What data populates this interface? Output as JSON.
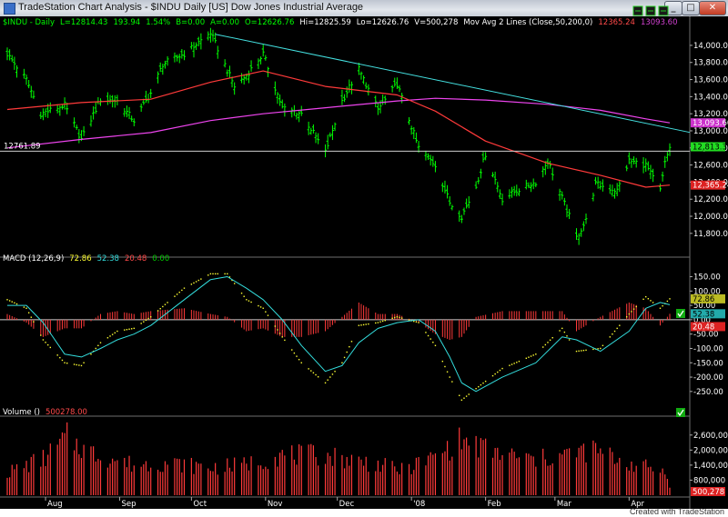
{
  "window": {
    "title": "TradeStation Chart Analysis - $INDU  Daily  [US] Dow Jones Industrial Average",
    "footer": "Created with TradeStation"
  },
  "price_panel": {
    "header": [
      {
        "text": "$INDU - Daily",
        "color": "#00ff00"
      },
      {
        "text": "L=12814.43",
        "color": "#00ff00"
      },
      {
        "text": "193.94",
        "color": "#00ff00"
      },
      {
        "text": "1.54%",
        "color": "#00ff00"
      },
      {
        "text": "B=0.00",
        "color": "#00ff00"
      },
      {
        "text": "A=0.00",
        "color": "#00ff00"
      },
      {
        "text": "O=12626.76",
        "color": "#00ff00"
      },
      {
        "text": "Hi=12825.59",
        "color": "#ffffff"
      },
      {
        "text": "Lo=12626.76",
        "color": "#ffffff"
      },
      {
        "text": "V=500,278",
        "color": "#ffffff"
      },
      {
        "text": "Mov Avg 2 Lines (Close,50,200,0)",
        "color": "#ffffff"
      },
      {
        "text": "12365.24",
        "color": "#ff4a4a"
      },
      {
        "text": "13093.60",
        "color": "#d040d0"
      }
    ],
    "hline_label": "12761.89",
    "flags": {
      "last": "12,813.37",
      "ma50": "12,365.24",
      "ma200": "13,093.60"
    }
  },
  "macd_panel": {
    "header": [
      {
        "text": "MACD (12,26,9)",
        "color": "#ffffff"
      },
      {
        "text": "72.86",
        "color": "#ffff33"
      },
      {
        "text": "52.38",
        "color": "#33dddd"
      },
      {
        "text": "20.48",
        "color": "#ff4a4a"
      },
      {
        "text": "0.00",
        "color": "#00cc00"
      }
    ],
    "flags": {
      "a": "72.86",
      "b": "52.38",
      "c": "20.48"
    }
  },
  "volume_panel": {
    "header": [
      {
        "text": "Volume ()",
        "color": "#ffffff"
      },
      {
        "text": "500278.00",
        "color": "#ff4a4a"
      }
    ],
    "flag": "500,278"
  },
  "colors": {
    "bars": "#00ff00",
    "ma50": "#ff3a3a",
    "ma200": "#ee44ee",
    "trend": "#44e0e0",
    "hist": "#ff3a3a",
    "macd": "#ffff33",
    "signal": "#33dddd",
    "volume": "#ff3a3a"
  },
  "chart_data": [
    {
      "type": "ohlc",
      "title": "$INDU - Daily",
      "x_categories": [
        "Aug",
        "Sep",
        "Oct",
        "Nov",
        "Dec",
        "'08",
        "Feb",
        "Mar",
        "Apr"
      ],
      "y_ticks": [
        "14,000.00",
        "13,800.00",
        "13,600.00",
        "13,400.00",
        "13,200.00",
        "13,000.00",
        "12,800.00",
        "12,600.00",
        "12,400.00",
        "12,200.00",
        "12,000.00",
        "11,800.00"
      ],
      "ylim": [
        11660,
        14180
      ],
      "close_anchors": [
        {
          "date": "2007-07-16",
          "close": 13900
        },
        {
          "date": "2007-07-24",
          "close": 13600
        },
        {
          "date": "2007-07-30",
          "close": 13200
        },
        {
          "date": "2007-08-09",
          "close": 13300
        },
        {
          "date": "2007-08-16",
          "close": 12900
        },
        {
          "date": "2007-08-24",
          "close": 13370
        },
        {
          "date": "2007-08-31",
          "close": 13350
        },
        {
          "date": "2007-09-07",
          "close": 13120
        },
        {
          "date": "2007-09-14",
          "close": 13440
        },
        {
          "date": "2007-09-19",
          "close": 13780
        },
        {
          "date": "2007-09-28",
          "close": 13900
        },
        {
          "date": "2007-10-09",
          "close": 14150
        },
        {
          "date": "2007-10-19",
          "close": 13520
        },
        {
          "date": "2007-10-24",
          "close": 13650
        },
        {
          "date": "2007-10-31",
          "close": 13900
        },
        {
          "date": "2007-11-08",
          "close": 13270
        },
        {
          "date": "2007-11-16",
          "close": 13200
        },
        {
          "date": "2007-11-26",
          "close": 12750
        },
        {
          "date": "2007-12-03",
          "close": 13350
        },
        {
          "date": "2007-12-10",
          "close": 13720
        },
        {
          "date": "2007-12-18",
          "close": 13250
        },
        {
          "date": "2007-12-26",
          "close": 13550
        },
        {
          "date": "2008-01-04",
          "close": 12800
        },
        {
          "date": "2008-01-11",
          "close": 12600
        },
        {
          "date": "2008-01-17",
          "close": 12160
        },
        {
          "date": "2008-01-22",
          "close": 12000
        },
        {
          "date": "2008-01-28",
          "close": 12350
        },
        {
          "date": "2008-02-01",
          "close": 12730
        },
        {
          "date": "2008-02-08",
          "close": 12200
        },
        {
          "date": "2008-02-14",
          "close": 12300
        },
        {
          "date": "2008-02-22",
          "close": 12400
        },
        {
          "date": "2008-02-27",
          "close": 12650
        },
        {
          "date": "2008-03-07",
          "close": 12000
        },
        {
          "date": "2008-03-10",
          "close": 11750
        },
        {
          "date": "2008-03-14",
          "close": 11950
        },
        {
          "date": "2008-03-18",
          "close": 12380
        },
        {
          "date": "2008-03-20",
          "close": 12360
        },
        {
          "date": "2008-03-27",
          "close": 12300
        },
        {
          "date": "2008-04-01",
          "close": 12650
        },
        {
          "date": "2008-04-08",
          "close": 12600
        },
        {
          "date": "2008-04-14",
          "close": 12300
        },
        {
          "date": "2008-04-16",
          "close": 12620
        },
        {
          "date": "2008-04-18",
          "close": 12813.37
        }
      ],
      "ma50_anchors": [
        {
          "date": "2007-07-16",
          "value": 13250
        },
        {
          "date": "2007-08-16",
          "value": 13330
        },
        {
          "date": "2007-09-14",
          "value": 13370
        },
        {
          "date": "2007-10-09",
          "value": 13570
        },
        {
          "date": "2007-10-31",
          "value": 13700
        },
        {
          "date": "2007-11-26",
          "value": 13520
        },
        {
          "date": "2007-12-26",
          "value": 13420
        },
        {
          "date": "2008-01-11",
          "value": 13230
        },
        {
          "date": "2008-02-01",
          "value": 12880
        },
        {
          "date": "2008-02-27",
          "value": 12620
        },
        {
          "date": "2008-03-20",
          "value": 12480
        },
        {
          "date": "2008-04-08",
          "value": 12340
        },
        {
          "date": "2008-04-18",
          "value": 12365.24
        }
      ],
      "ma200_anchors": [
        {
          "date": "2007-07-16",
          "value": 12800
        },
        {
          "date": "2007-08-16",
          "value": 12900
        },
        {
          "date": "2007-09-14",
          "value": 12980
        },
        {
          "date": "2007-10-09",
          "value": 13120
        },
        {
          "date": "2007-10-31",
          "value": 13200
        },
        {
          "date": "2007-11-26",
          "value": 13270
        },
        {
          "date": "2007-12-26",
          "value": 13350
        },
        {
          "date": "2008-01-11",
          "value": 13380
        },
        {
          "date": "2008-02-01",
          "value": 13360
        },
        {
          "date": "2008-02-27",
          "value": 13310
        },
        {
          "date": "2008-03-20",
          "value": 13240
        },
        {
          "date": "2008-04-08",
          "value": 13140
        },
        {
          "date": "2008-04-18",
          "value": 13093.6
        }
      ],
      "trendline": [
        {
          "date": "2007-10-11",
          "value": 14130
        },
        {
          "date": "2008-04-18",
          "value": 12950
        }
      ],
      "horizontal_line": 12761.89
    },
    {
      "type": "line",
      "title": "MACD (12,26,9)",
      "y_ticks": [
        "150.00",
        "100.00",
        "50.00",
        "0.00",
        "-50.00",
        "-100.00",
        "-150.00",
        "-200.00",
        "-250.00"
      ],
      "ylim": [
        -298,
        196
      ],
      "macd_anchors": [
        {
          "date": "2007-07-16",
          "value": 70
        },
        {
          "date": "2007-07-24",
          "value": 40
        },
        {
          "date": "2007-07-31",
          "value": -70
        },
        {
          "date": "2007-08-09",
          "value": -150
        },
        {
          "date": "2007-08-16",
          "value": -160
        },
        {
          "date": "2007-08-24",
          "value": -80
        },
        {
          "date": "2007-08-31",
          "value": -40
        },
        {
          "date": "2007-09-07",
          "value": -30
        },
        {
          "date": "2007-09-14",
          "value": 10
        },
        {
          "date": "2007-09-28",
          "value": 110
        },
        {
          "date": "2007-10-09",
          "value": 160
        },
        {
          "date": "2007-10-16",
          "value": 160
        },
        {
          "date": "2007-10-24",
          "value": 70
        },
        {
          "date": "2007-10-31",
          "value": 40
        },
        {
          "date": "2007-11-08",
          "value": -60
        },
        {
          "date": "2007-11-16",
          "value": -150
        },
        {
          "date": "2007-11-26",
          "value": -220
        },
        {
          "date": "2007-12-03",
          "value": -150
        },
        {
          "date": "2007-12-10",
          "value": -20
        },
        {
          "date": "2007-12-18",
          "value": -10
        },
        {
          "date": "2007-12-26",
          "value": 10
        },
        {
          "date": "2008-01-04",
          "value": -10
        },
        {
          "date": "2008-01-11",
          "value": -90
        },
        {
          "date": "2008-01-17",
          "value": -200
        },
        {
          "date": "2008-01-22",
          "value": -280
        },
        {
          "date": "2008-01-28",
          "value": -240
        },
        {
          "date": "2008-02-08",
          "value": -170
        },
        {
          "date": "2008-02-22",
          "value": -120
        },
        {
          "date": "2008-03-04",
          "value": -30
        },
        {
          "date": "2008-03-10",
          "value": -110
        },
        {
          "date": "2008-03-20",
          "value": -100
        },
        {
          "date": "2008-04-01",
          "value": 20
        },
        {
          "date": "2008-04-08",
          "value": 80
        },
        {
          "date": "2008-04-14",
          "value": 40
        },
        {
          "date": "2008-04-18",
          "value": 72.86
        }
      ],
      "signal_anchors": [
        {
          "date": "2007-07-16",
          "value": 50
        },
        {
          "date": "2007-07-24",
          "value": 50
        },
        {
          "date": "2007-07-31",
          "value": -10
        },
        {
          "date": "2007-08-09",
          "value": -120
        },
        {
          "date": "2007-08-16",
          "value": -130
        },
        {
          "date": "2007-08-24",
          "value": -100
        },
        {
          "date": "2007-08-31",
          "value": -70
        },
        {
          "date": "2007-09-07",
          "value": -50
        },
        {
          "date": "2007-09-14",
          "value": -20
        },
        {
          "date": "2007-09-28",
          "value": 70
        },
        {
          "date": "2007-10-09",
          "value": 140
        },
        {
          "date": "2007-10-16",
          "value": 150
        },
        {
          "date": "2007-10-24",
          "value": 110
        },
        {
          "date": "2007-10-31",
          "value": 70
        },
        {
          "date": "2007-11-08",
          "value": 0
        },
        {
          "date": "2007-11-16",
          "value": -90
        },
        {
          "date": "2007-11-26",
          "value": -180
        },
        {
          "date": "2007-12-03",
          "value": -160
        },
        {
          "date": "2007-12-10",
          "value": -80
        },
        {
          "date": "2007-12-18",
          "value": -30
        },
        {
          "date": "2007-12-26",
          "value": -10
        },
        {
          "date": "2008-01-04",
          "value": 0
        },
        {
          "date": "2008-01-11",
          "value": -40
        },
        {
          "date": "2008-01-17",
          "value": -130
        },
        {
          "date": "2008-01-22",
          "value": -220
        },
        {
          "date": "2008-01-28",
          "value": -250
        },
        {
          "date": "2008-02-08",
          "value": -200
        },
        {
          "date": "2008-02-22",
          "value": -150
        },
        {
          "date": "2008-03-04",
          "value": -60
        },
        {
          "date": "2008-03-10",
          "value": -70
        },
        {
          "date": "2008-03-20",
          "value": -110
        },
        {
          "date": "2008-04-01",
          "value": -40
        },
        {
          "date": "2008-04-08",
          "value": 40
        },
        {
          "date": "2008-04-14",
          "value": 60
        },
        {
          "date": "2008-04-18",
          "value": 52.38
        }
      ]
    },
    {
      "type": "bar",
      "title": "Volume ()",
      "y_ticks": [
        "2,600,000",
        "2,000,000",
        "1,400,000",
        "800,000"
      ],
      "ylim": [
        200000,
        3100000
      ],
      "volume_anchors": [
        {
          "date": "2007-07-16",
          "value": 1100000
        },
        {
          "date": "2007-08-01",
          "value": 1700000
        },
        {
          "date": "2007-08-10",
          "value": 2500000
        },
        {
          "date": "2007-08-20",
          "value": 1900000
        },
        {
          "date": "2007-09-07",
          "value": 1400000
        },
        {
          "date": "2007-09-20",
          "value": 1500000
        },
        {
          "date": "2007-10-09",
          "value": 1300000
        },
        {
          "date": "2007-10-22",
          "value": 1400000
        },
        {
          "date": "2007-11-08",
          "value": 1800000
        },
        {
          "date": "2007-11-26",
          "value": 1800000
        },
        {
          "date": "2007-12-14",
          "value": 1500000
        },
        {
          "date": "2007-12-28",
          "value": 1200000
        },
        {
          "date": "2008-01-10",
          "value": 1700000
        },
        {
          "date": "2008-01-22",
          "value": 2400000
        },
        {
          "date": "2008-02-05",
          "value": 1900000
        },
        {
          "date": "2008-02-22",
          "value": 1600000
        },
        {
          "date": "2008-03-10",
          "value": 1900000
        },
        {
          "date": "2008-03-17",
          "value": 2000000
        },
        {
          "date": "2008-03-31",
          "value": 1500000
        },
        {
          "date": "2008-04-18",
          "value": 1100000
        }
      ],
      "last": 500278
    }
  ]
}
